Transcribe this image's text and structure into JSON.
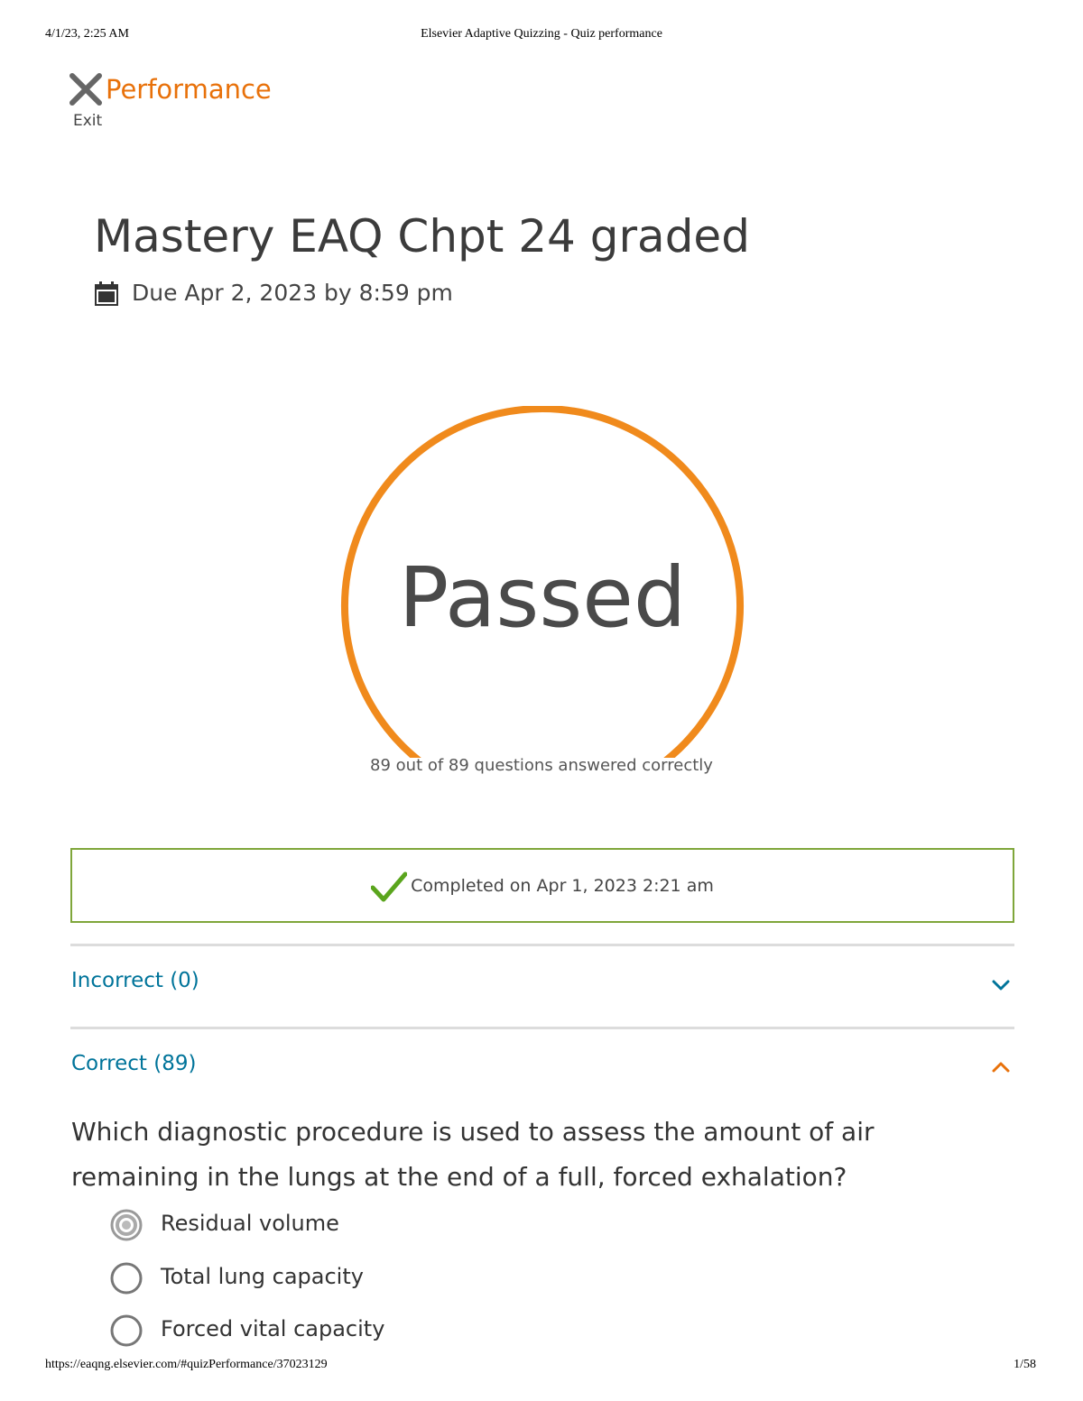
{
  "print_header": {
    "datetime": "4/1/23, 2:25 AM",
    "page_title": "Elsevier Adaptive Quizzing - Quiz performance"
  },
  "print_footer": {
    "url": "https://eaqng.elsevier.com/#quizPerformance/37023129",
    "page": "1/58"
  },
  "header": {
    "exit_icon": "close-x-icon",
    "exit_label": "Exit",
    "title": "Performance"
  },
  "quiz": {
    "title": "Mastery EAQ Chpt 24 graded",
    "due_icon": "calendar-icon",
    "due": "Due Apr 2, 2023 by 8:59 pm"
  },
  "result": {
    "status": "Passed",
    "correct": 89,
    "total": 89,
    "summary": "89 out of 89 questions answered correctly",
    "completed_icon": "checkmark-icon",
    "completed": "Completed on Apr 1, 2023 2:21 am"
  },
  "sections": {
    "incorrect": {
      "label": "Incorrect (0)",
      "icon": "chevron-down-icon",
      "expanded": false
    },
    "correct": {
      "label": "Correct (89)",
      "icon": "chevron-up-icon",
      "expanded": true
    }
  },
  "question": {
    "text": "Which diagnostic procedure is used to assess the amount of air remaining in the lungs at the end of a full, forced exhalation?",
    "options": [
      {
        "label": "Residual volume",
        "selected": true
      },
      {
        "label": "Total lung capacity",
        "selected": false
      },
      {
        "label": "Forced vital capacity",
        "selected": false
      }
    ]
  },
  "colors": {
    "accent_orange": "#f08a1c",
    "link_blue": "#00749a",
    "success_green": "#5aa51d",
    "box_border": "#7fa63a"
  }
}
